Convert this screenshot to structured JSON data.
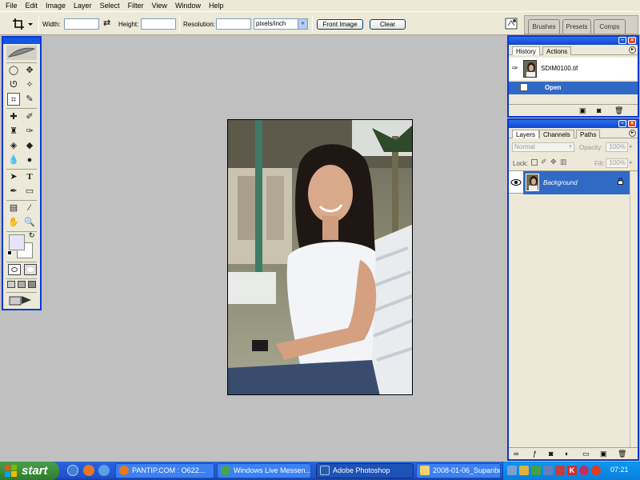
{
  "menu": [
    "File",
    "Edit",
    "Image",
    "Layer",
    "Select",
    "Filter",
    "View",
    "Window",
    "Help"
  ],
  "options": {
    "width_label": "Width:",
    "height_label": "Height:",
    "resolution_label": "Resolution:",
    "resolution_unit": "pixels/inch",
    "front_image": "Front Image",
    "clear": "Clear"
  },
  "wells": {
    "brushes": "Brushes",
    "presets": "Presets",
    "comps": "Comps"
  },
  "history": {
    "tabs": [
      "History",
      "Actions"
    ],
    "snapshot": "SDIM0100.tif",
    "step": "Open"
  },
  "layers": {
    "tabs": [
      "Layers",
      "Channels",
      "Paths"
    ],
    "blend_mode": "Normal",
    "opacity_label": "Opacity:",
    "opacity": "100%",
    "lock_label": "Lock:",
    "fill_label": "Fill:",
    "fill": "100%",
    "layer_name": "Background"
  },
  "taskbar": {
    "start": "start",
    "tasks": [
      "PANTIP.COM : O622...",
      "Windows Live Messen...",
      "Adobe Photoshop",
      "2008-01-06_Supanbu..."
    ],
    "clock": "07:21"
  },
  "icons": {
    "crop_tool": "crop-icon",
    "swap": "swap-icon",
    "eye": "eye-icon",
    "lock": "lock-icon"
  },
  "colors": {
    "xp_blue": "#0a38d4",
    "selection": "#316ac5",
    "start_green": "#3c8f3c",
    "canvas_gray": "#c0c0c0"
  }
}
